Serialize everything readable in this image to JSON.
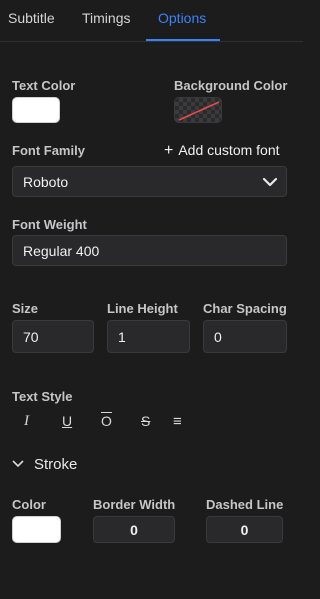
{
  "tabs": [
    {
      "label": "Subtitle",
      "active": false
    },
    {
      "label": "Timings",
      "active": false
    },
    {
      "label": "Options",
      "active": true
    }
  ],
  "colors": {
    "accent": "#3b82f6",
    "background": "#1c1c1d",
    "text_color": "#ffffff",
    "stroke_color": "#ffffff"
  },
  "text_color": {
    "label": "Text Color",
    "value": "#ffffff"
  },
  "background_color": {
    "label": "Background Color",
    "value": "transparent"
  },
  "font_family": {
    "label": "Font Family",
    "add_custom_label": "Add custom font",
    "value": "Roboto"
  },
  "font_weight": {
    "label": "Font Weight",
    "value": "Regular 400"
  },
  "size": {
    "label": "Size",
    "value": "70"
  },
  "line_height": {
    "label": "Line Height",
    "value": "1"
  },
  "char_spacing": {
    "label": "Char Spacing",
    "value": "0"
  },
  "text_style": {
    "label": "Text Style",
    "icons": [
      {
        "name": "italic-icon",
        "glyph": "I"
      },
      {
        "name": "underline-icon",
        "glyph": "U"
      },
      {
        "name": "overline-icon",
        "glyph": "O"
      },
      {
        "name": "strikethrough-icon",
        "glyph": "S"
      },
      {
        "name": "align-lines-icon",
        "glyph": "≡"
      }
    ]
  },
  "stroke": {
    "title": "Stroke",
    "color": {
      "label": "Color",
      "value": "#ffffff"
    },
    "border_width": {
      "label": "Border Width",
      "value": "0"
    },
    "dashed_line": {
      "label": "Dashed Line",
      "value": "0"
    }
  }
}
